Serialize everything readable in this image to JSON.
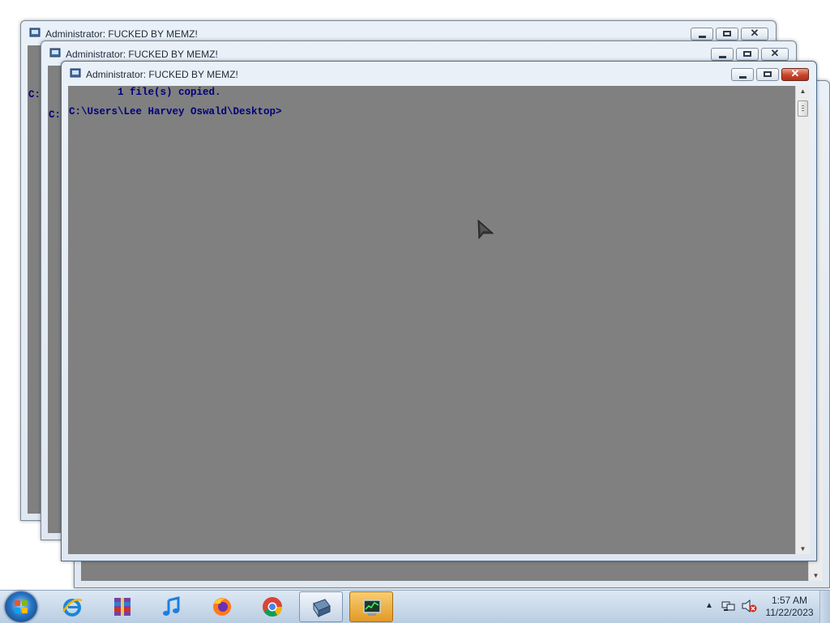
{
  "windows": [
    {
      "title": "Administrator:  FUCKED BY MEMZ!",
      "lines": []
    },
    {
      "title": "Administrator:  FUCKED BY MEMZ!",
      "lines": []
    },
    {
      "title": "Administrator:  FUCKED BY MEMZ!",
      "lines": []
    },
    {
      "title": "Administrator:  FUCKED BY MEMZ!",
      "lines": [
        "        1 file(s) copied.",
        "C:\\Users\\Lee Harvey Oswald\\Desktop>"
      ]
    }
  ],
  "peek_text": {
    "back_window_prompt": "C:",
    "middle_window_prompt": "C:"
  },
  "window_icon": "cmd-console-icon",
  "taskbar": {
    "start": "windows-start-orb",
    "pinned": [
      {
        "icon": "winrar-icon",
        "state": "idle"
      },
      {
        "icon": "internet-explorer-icon",
        "state": "idle"
      },
      {
        "icon": "itunes-icon",
        "state": "idle"
      },
      {
        "icon": "firefox-icon",
        "state": "idle"
      },
      {
        "icon": "chrome-icon",
        "state": "idle"
      },
      {
        "icon": "cmd-icon",
        "state": "active"
      },
      {
        "icon": "task-manager-icon",
        "state": "running"
      }
    ],
    "clock": {
      "time": "1:57 AM",
      "date": "11/22/2023"
    }
  },
  "colors": {
    "console_background": "#808080",
    "console_text": "#00007a",
    "taskbar": "#c8d8ea"
  }
}
